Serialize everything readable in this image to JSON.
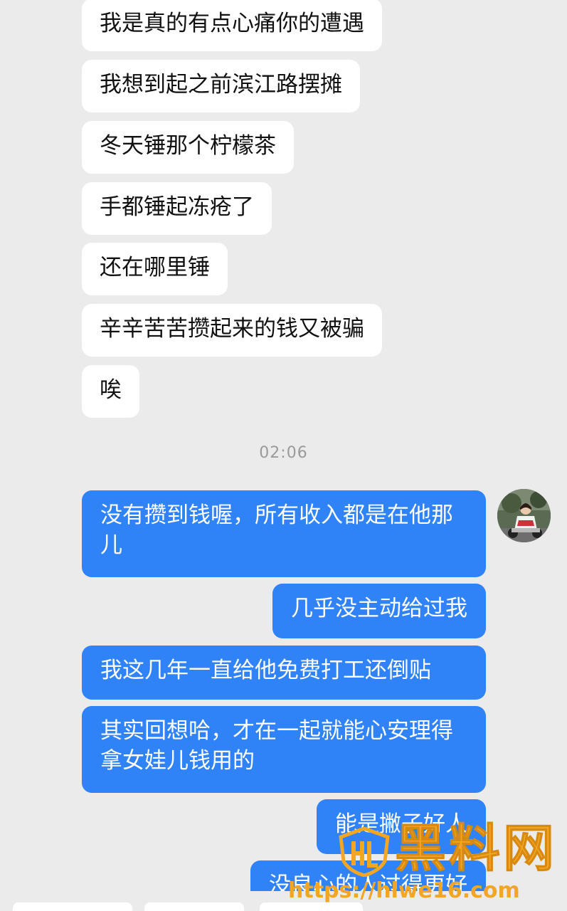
{
  "incoming_messages": [
    {
      "text": "我是真的有点心痛你的遭遇"
    },
    {
      "text": "我想到起之前滨江路摆摊"
    },
    {
      "text": "冬天锤那个柠檬茶"
    },
    {
      "text": "手都锤起冻疮了"
    },
    {
      "text": "还在哪里锤"
    },
    {
      "text": "辛辛苦苦攒起来的钱又被骗"
    },
    {
      "text": "唉"
    }
  ],
  "timestamp": "02:06",
  "outgoing_messages": [
    {
      "text": "没有攒到钱喔，所有收入都是在他那儿"
    },
    {
      "text": "几乎没主动给过我"
    },
    {
      "text": "我这几年一直给他免费打工还倒贴"
    },
    {
      "text": "其实回想哈，才在一起就能心安理得拿女娃儿钱用的"
    },
    {
      "text": "能是撇子好人"
    },
    {
      "text": "没良心的人过得更好"
    }
  ],
  "avatar": {
    "icon": "user-photo-avatar"
  },
  "watermark": {
    "title": "黑料网",
    "url": "https://hlwe16.com",
    "logo_icon": "hl-shield-logo",
    "color": "#f3a623"
  },
  "colors": {
    "background": "#ebebeb",
    "incoming_bubble": "#ffffff",
    "outgoing_bubble": "#2f83f6",
    "timestamp_text": "#9a9a9a"
  }
}
